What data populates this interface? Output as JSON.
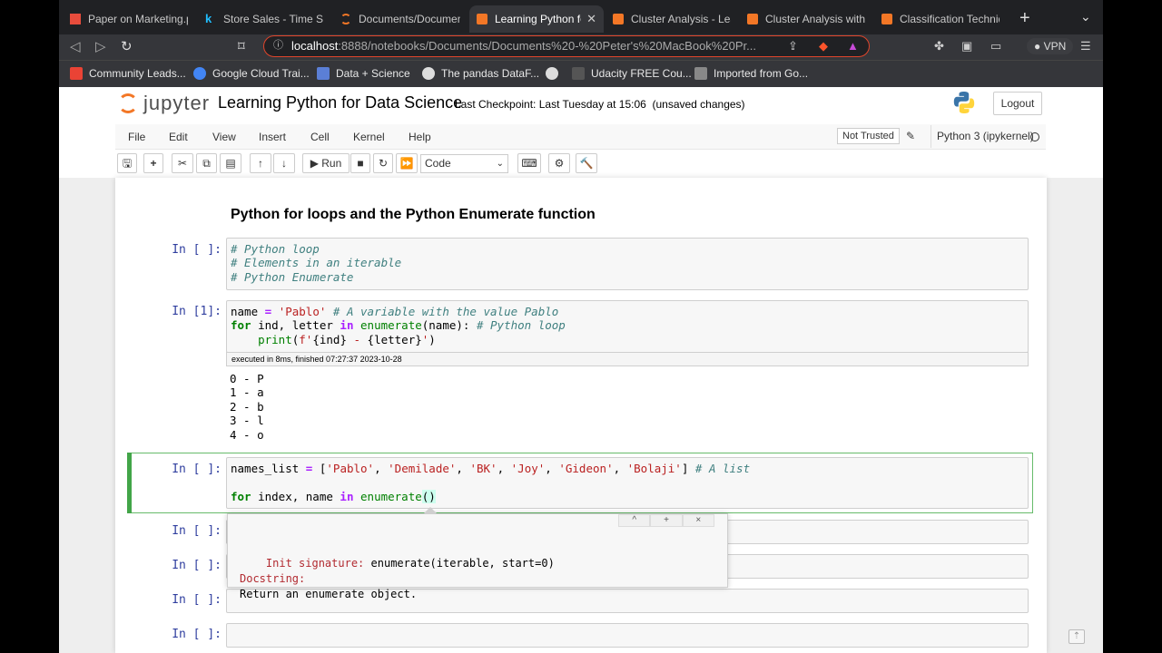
{
  "browser": {
    "tabs": [
      {
        "title": "Paper on Marketing.pdf",
        "icon": "pdf-icon",
        "color": "#e74c3c"
      },
      {
        "title": "Store Sales - Time Series",
        "icon": "kaggle-icon",
        "color": "#20beff"
      },
      {
        "title": "Documents/Documents",
        "icon": "jupyter-icon",
        "color": "#f37726"
      },
      {
        "title": "Learning Python for",
        "icon": "book-icon",
        "color": "#f37726",
        "active": true
      },
      {
        "title": "Cluster Analysis - Lear",
        "icon": "book-icon",
        "color": "#f37726"
      },
      {
        "title": "Cluster Analysis with B",
        "icon": "book-icon",
        "color": "#f37726"
      },
      {
        "title": "Classification Techniqu",
        "icon": "book-icon",
        "color": "#f37726"
      }
    ],
    "url_host": "localhost",
    "url_rest": ":8888/notebooks/Documents/Documents%20-%20Peter's%20MacBook%20Pr...",
    "vpn_label": "VPN",
    "bookmarks": [
      "Community Leads...",
      "Google Cloud Trai...",
      "Data + Science",
      "The pandas DataF...",
      "",
      "Udacity FREE Cou...",
      "Imported from Go..."
    ]
  },
  "jupyter": {
    "logo_text": "jupyter",
    "notebook_title": "Learning Python for Data Science",
    "checkpoint": "Last Checkpoint: Last Tuesday at 15:06",
    "unsaved": "(unsaved changes)",
    "logout": "Logout",
    "menu": [
      "File",
      "Edit",
      "View",
      "Insert",
      "Cell",
      "Kernel",
      "Help"
    ],
    "trust": "Not Trusted",
    "kernel": "Python 3 (ipykernel)",
    "run_label": "Run",
    "cell_type": "Code"
  },
  "notebook": {
    "heading": "Python for loops and the Python Enumerate function",
    "prompts": {
      "p1": "In [ ]:",
      "p2": "In [1]:",
      "p3": "In [ ]:",
      "p4": "In [ ]:",
      "p5": "In [ ]:",
      "p6": "In [ ]:",
      "p7": "In [ ]:"
    },
    "cell1": [
      "# Python loop",
      "# Elements in an iterable",
      "# Python Enumerate"
    ],
    "cell2_exec": "executed in 8ms, finished 07:27:37 2023-10-28",
    "cell2_output": [
      "0 - P",
      "1 - a",
      "2 - b",
      "3 - l",
      "4 - o"
    ],
    "tooltip": {
      "sig_label": "Init signature:",
      "sig": "enumerate(iterable, start=0)",
      "doc_label": "Docstring:",
      "doc": "Return an enumerate object.",
      "buttons": [
        "^",
        "+",
        "×"
      ]
    }
  }
}
